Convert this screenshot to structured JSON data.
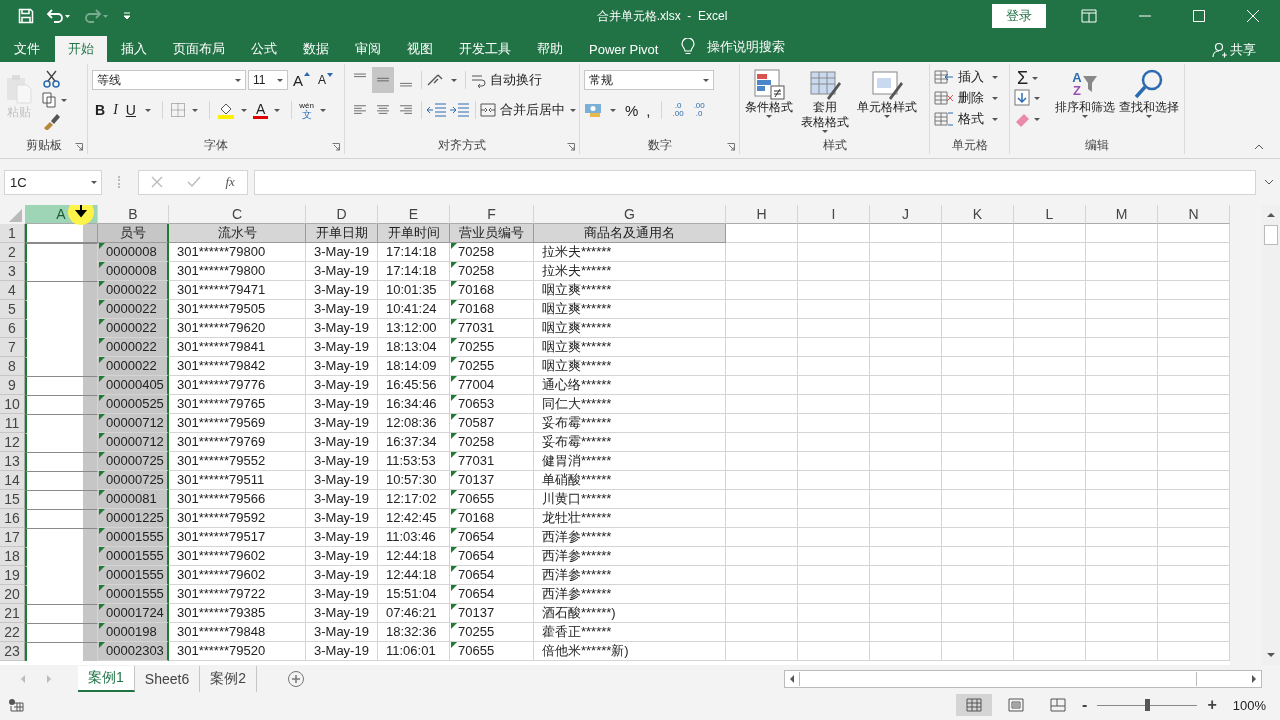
{
  "title_bar": {
    "quick_access": [
      {
        "kind": "save",
        "disabled": false
      },
      {
        "kind": "undo",
        "disabled": false
      },
      {
        "kind": "redo",
        "disabled": true
      },
      {
        "kind": "customize",
        "disabled": false
      }
    ],
    "title": "合并单元格.xlsx  -  Excel",
    "login": "登录"
  },
  "tabs": [
    {
      "label": "文件",
      "selected": false
    },
    {
      "label": "开始",
      "selected": true
    },
    {
      "label": "插入",
      "selected": false
    },
    {
      "label": "页面布局",
      "selected": false
    },
    {
      "label": "公式",
      "selected": false
    },
    {
      "label": "数据",
      "selected": false
    },
    {
      "label": "审阅",
      "selected": false
    },
    {
      "label": "视图",
      "selected": false
    },
    {
      "label": "开发工具",
      "selected": false
    },
    {
      "label": "帮助",
      "selected": false
    },
    {
      "label": "Power Pivot",
      "selected": false
    }
  ],
  "tell_me": "操作说明搜索",
  "share": "共享",
  "ribbon": {
    "clipboard": {
      "label": "剪贴板",
      "paste": {
        "label": "粘贴",
        "disabled": true
      }
    },
    "font": {
      "label": "字体",
      "family": "等线",
      "size": "11",
      "grow": "A",
      "shrink": "A",
      "bold": "B",
      "italic": "I",
      "underline": "U",
      "font_color": "A",
      "phonetic": [
        "wén",
        "文"
      ]
    },
    "alignment": {
      "label": "对齐方式",
      "vertical": [
        {
          "kind": "top",
          "selected": false
        },
        {
          "kind": "middle",
          "selected": true
        },
        {
          "kind": "bottom",
          "selected": false
        }
      ],
      "horizontal": [
        {
          "kind": "left",
          "selected": false
        },
        {
          "kind": "center",
          "selected": false
        },
        {
          "kind": "right",
          "selected": false
        }
      ],
      "wrap": "自动换行",
      "merge": "合并后居中"
    },
    "number": {
      "label": "数字",
      "format": "常规",
      "percent": "%",
      "comma": ",",
      "decimals": [
        {
          "top": ".0",
          "bottom": ".00"
        },
        {
          "top": ".00",
          "bottom": ".0"
        }
      ]
    },
    "styles": {
      "label": "样式",
      "items": [
        {
          "kind": "conditional",
          "lines": [
            "条件格式"
          ]
        },
        {
          "kind": "table",
          "lines": [
            "套用",
            "表格格式"
          ]
        },
        {
          "kind": "cell",
          "lines": [
            "单元格样式"
          ]
        }
      ]
    },
    "cells": {
      "label": "单元格",
      "items": [
        {
          "kind": "insert",
          "label": "插入"
        },
        {
          "kind": "delete",
          "label": "删除"
        },
        {
          "kind": "format",
          "label": "格式"
        }
      ]
    },
    "editing": {
      "label": "编辑",
      "sum": "Σ",
      "sort_letters": [
        "A",
        "Z"
      ],
      "sort": "排序和筛选",
      "find": "查找和选择"
    }
  },
  "formula_bar": {
    "name_box": "1C",
    "fx": "fx"
  },
  "columns": [
    {
      "letter": "A",
      "selected": true,
      "flagged": false
    },
    {
      "letter": "B",
      "selected": false,
      "flagged": true
    },
    {
      "letter": "C",
      "selected": false,
      "flagged": false
    },
    {
      "letter": "D",
      "selected": false,
      "flagged": false
    },
    {
      "letter": "E",
      "selected": false,
      "flagged": false
    },
    {
      "letter": "F",
      "selected": false,
      "flagged": true
    },
    {
      "letter": "G",
      "selected": false,
      "flagged": false
    },
    {
      "letter": "H",
      "selected": false,
      "flagged": false
    },
    {
      "letter": "I",
      "selected": false,
      "flagged": false
    },
    {
      "letter": "J",
      "selected": false,
      "flagged": false
    },
    {
      "letter": "K",
      "selected": false,
      "flagged": false
    },
    {
      "letter": "L",
      "selected": false,
      "flagged": false
    },
    {
      "letter": "M",
      "selected": false,
      "flagged": false
    },
    {
      "letter": "N",
      "selected": false,
      "flagged": false
    }
  ],
  "header_row": {
    "num": "1",
    "cells": [
      "员号",
      "流水号",
      "开单日期",
      "开单时间",
      "营业员编号",
      "商品名及通用名"
    ]
  },
  "rows": [
    {
      "num": "2",
      "a_continues": false,
      "id": "0000008",
      "serial": "301******79800",
      "date": "3-May-19",
      "time": "17:14:18",
      "clerk": "70258",
      "product": "拉米夫******"
    },
    {
      "num": "3",
      "a_continues": true,
      "id": "0000008",
      "serial": "301******79800",
      "date": "3-May-19",
      "time": "17:14:18",
      "clerk": "70258",
      "product": "拉米夫******"
    },
    {
      "num": "4",
      "a_continues": false,
      "id": "0000022",
      "serial": "301******79471",
      "date": "3-May-19",
      "time": "10:01:35",
      "clerk": "70168",
      "product": "咽立爽******"
    },
    {
      "num": "5",
      "a_continues": true,
      "id": "0000022",
      "serial": "301******79505",
      "date": "3-May-19",
      "time": "10:41:24",
      "clerk": "70168",
      "product": "咽立爽******"
    },
    {
      "num": "6",
      "a_continues": true,
      "id": "0000022",
      "serial": "301******79620",
      "date": "3-May-19",
      "time": "13:12:00",
      "clerk": "77031",
      "product": "咽立爽******"
    },
    {
      "num": "7",
      "a_continues": true,
      "id": "0000022",
      "serial": "301******79841",
      "date": "3-May-19",
      "time": "18:13:04",
      "clerk": "70255",
      "product": "咽立爽******"
    },
    {
      "num": "8",
      "a_continues": true,
      "id": "0000022",
      "serial": "301******79842",
      "date": "3-May-19",
      "time": "18:14:09",
      "clerk": "70255",
      "product": "咽立爽******"
    },
    {
      "num": "9",
      "a_continues": false,
      "id": "00000405",
      "serial": "301******79776",
      "date": "3-May-19",
      "time": "16:45:56",
      "clerk": "77004",
      "product": "通心络******"
    },
    {
      "num": "10",
      "a_continues": false,
      "id": "00000525",
      "serial": "301******79765",
      "date": "3-May-19",
      "time": "16:34:46",
      "clerk": "70653",
      "product": "同仁大******"
    },
    {
      "num": "11",
      "a_continues": false,
      "id": "00000712",
      "serial": "301******79569",
      "date": "3-May-19",
      "time": "12:08:36",
      "clerk": "70587",
      "product": "妥布霉******"
    },
    {
      "num": "12",
      "a_continues": true,
      "id": "00000712",
      "serial": "301******79769",
      "date": "3-May-19",
      "time": "16:37:34",
      "clerk": "70258",
      "product": "妥布霉******"
    },
    {
      "num": "13",
      "a_continues": false,
      "id": "00000725",
      "serial": "301******79552",
      "date": "3-May-19",
      "time": "11:53:53",
      "clerk": "77031",
      "product": "健胃消******"
    },
    {
      "num": "14",
      "a_continues": false,
      "id": "00000725",
      "serial": "301******79511",
      "date": "3-May-19",
      "time": "10:57:30",
      "clerk": "70137",
      "product": "单硝酸******"
    },
    {
      "num": "15",
      "a_continues": false,
      "id": "0000081",
      "serial": "301******79566",
      "date": "3-May-19",
      "time": "12:17:02",
      "clerk": "70655",
      "product": "川黄口******"
    },
    {
      "num": "16",
      "a_continues": false,
      "id": "00001225",
      "serial": "301******79592",
      "date": "3-May-19",
      "time": "12:42:45",
      "clerk": "70168",
      "product": "龙牡壮******"
    },
    {
      "num": "17",
      "a_continues": false,
      "id": "00001555",
      "serial": "301******79517",
      "date": "3-May-19",
      "time": "11:03:46",
      "clerk": "70654",
      "product": "西洋参******"
    },
    {
      "num": "18",
      "a_continues": true,
      "id": "00001555",
      "serial": "301******79602",
      "date": "3-May-19",
      "time": "12:44:18",
      "clerk": "70654",
      "product": "西洋参******"
    },
    {
      "num": "19",
      "a_continues": true,
      "id": "00001555",
      "serial": "301******79602",
      "date": "3-May-19",
      "time": "12:44:18",
      "clerk": "70654",
      "product": "西洋参******"
    },
    {
      "num": "20",
      "a_continues": true,
      "id": "00001555",
      "serial": "301******79722",
      "date": "3-May-19",
      "time": "15:51:04",
      "clerk": "70654",
      "product": "西洋参******"
    },
    {
      "num": "21",
      "a_continues": false,
      "id": "00001724",
      "serial": "301******79385",
      "date": "3-May-19",
      "time": "07:46:21",
      "clerk": "70137",
      "product": "酒石酸******)"
    },
    {
      "num": "22",
      "a_continues": false,
      "id": "0000198",
      "serial": "301******79848",
      "date": "3-May-19",
      "time": "18:32:36",
      "clerk": "70255",
      "product": "藿香正******"
    },
    {
      "num": "23",
      "a_continues": false,
      "id": "00002303",
      "serial": "301******79520",
      "date": "3-May-19",
      "time": "11:06:01",
      "clerk": "70655",
      "product": "倍他米******新)"
    }
  ],
  "sheet_tabs": [
    {
      "label": "案例1",
      "selected": true
    },
    {
      "label": "Sheet6",
      "selected": false
    },
    {
      "label": "案例2",
      "selected": false
    }
  ],
  "status_bar": {
    "views": [
      {
        "kind": "normal",
        "selected": true
      },
      {
        "kind": "layout",
        "selected": false
      },
      {
        "kind": "break",
        "selected": false
      }
    ],
    "zoom_out": "-",
    "zoom_in": "+",
    "zoom": {
      "level": 0.5
    },
    "zoom_text": "100%"
  }
}
